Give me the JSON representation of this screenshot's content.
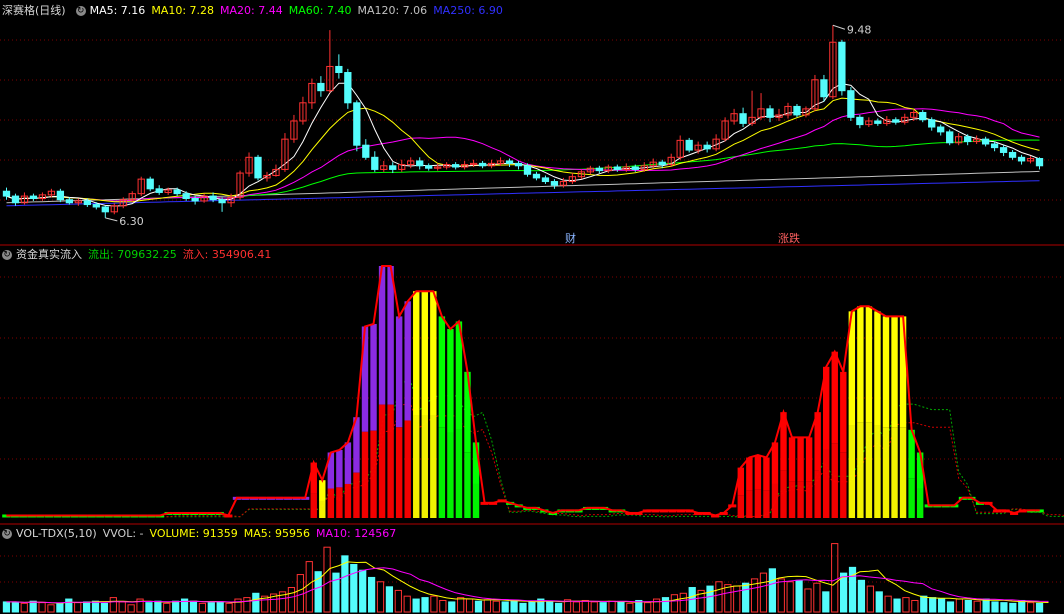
{
  "colors": {
    "background": "#000000",
    "up": "#ff3232",
    "down": "#54fcfc",
    "panel_border": "#b00000",
    "grid": "#800000",
    "ma5": "#ffffff",
    "ma10": "#ffff00",
    "ma20": "#ff00ff",
    "ma60": "#00ff00",
    "ma120": "#c0c0c0",
    "ma250": "#3030ff",
    "flow_out": "#00ff00",
    "flow_in": "#ff0000",
    "purple": "#8a2be2",
    "yellow": "#ffff00"
  },
  "price_panel": {
    "title": "深赛格(日线)",
    "settings_icon": "circle-arrow-icon",
    "indicators": [
      {
        "label": "MA5: 7.16",
        "color": "#ffffff"
      },
      {
        "label": "MA10: 7.28",
        "color": "#ffff00"
      },
      {
        "label": "MA20: 7.44",
        "color": "#ff00ff"
      },
      {
        "label": "MA60: 7.40",
        "color": "#00ff00"
      },
      {
        "label": "MA120: 7.06",
        "color": "#c0c0c0"
      },
      {
        "label": "MA250: 6.90",
        "color": "#3030ff"
      }
    ],
    "high_label": "9.48",
    "low_label": "6.30",
    "markers": [
      {
        "label": "财",
        "color": "#8ab4ff"
      },
      {
        "label": "涨跌",
        "color": "#ff6060"
      }
    ]
  },
  "flow_panel": {
    "title": "资金真实流入",
    "outflow_label": "流出: 709632.25",
    "inflow_label": "流入: 354906.41"
  },
  "volume_panel": {
    "title": "VOL-TDX(5,10)",
    "vvol_label": "VVOL: -",
    "volume_label": "VOLUME: 91359",
    "ma5_label": "MA5: 95956",
    "ma10_label": "MA10: 124567"
  },
  "chart_data": [
    {
      "type": "candlestick",
      "title": "深赛格(日线)",
      "y_range": [
        6.1,
        9.6
      ],
      "annotations": {
        "high": 9.48,
        "low": 6.3
      },
      "candles": [
        [
          6.74,
          6.66,
          6.8,
          6.6
        ],
        [
          6.66,
          6.55,
          6.7,
          6.5
        ],
        [
          6.55,
          6.66,
          6.72,
          6.52
        ],
        [
          6.66,
          6.62,
          6.7,
          6.58
        ],
        [
          6.62,
          6.68,
          6.72,
          6.58
        ],
        [
          6.68,
          6.74,
          6.78,
          6.64
        ],
        [
          6.74,
          6.6,
          6.78,
          6.56
        ],
        [
          6.6,
          6.55,
          6.64,
          6.52
        ],
        [
          6.55,
          6.58,
          6.62,
          6.5
        ],
        [
          6.58,
          6.52,
          6.62,
          6.48
        ],
        [
          6.52,
          6.48,
          6.56,
          6.44
        ],
        [
          6.48,
          6.4,
          6.5,
          6.3
        ],
        [
          6.4,
          6.5,
          6.54,
          6.36
        ],
        [
          6.5,
          6.6,
          6.64,
          6.46
        ],
        [
          6.6,
          6.7,
          6.74,
          6.56
        ],
        [
          6.7,
          6.94,
          6.98,
          6.66
        ],
        [
          6.94,
          6.78,
          6.98,
          6.74
        ],
        [
          6.78,
          6.72,
          6.84,
          6.68
        ],
        [
          6.72,
          6.76,
          6.8,
          6.68
        ],
        [
          6.76,
          6.7,
          6.8,
          6.66
        ],
        [
          6.7,
          6.62,
          6.74,
          6.58
        ],
        [
          6.62,
          6.58,
          6.66,
          6.52
        ],
        [
          6.58,
          6.66,
          6.7,
          6.55
        ],
        [
          6.66,
          6.6,
          6.72,
          6.56
        ],
        [
          6.6,
          6.55,
          6.64,
          6.4
        ],
        [
          6.55,
          6.64,
          6.7,
          6.48
        ],
        [
          6.64,
          7.04,
          7.08,
          6.6
        ],
        [
          7.04,
          7.3,
          7.38,
          6.98
        ],
        [
          7.3,
          6.96,
          7.34,
          6.92
        ],
        [
          6.96,
          7.0,
          7.06,
          6.9
        ],
        [
          7.0,
          7.1,
          7.18,
          6.98
        ],
        [
          7.1,
          7.6,
          7.7,
          7.06
        ],
        [
          7.6,
          7.9,
          8.0,
          7.54
        ],
        [
          7.9,
          8.2,
          8.3,
          7.84
        ],
        [
          8.2,
          8.52,
          8.6,
          8.1
        ],
        [
          8.52,
          8.4,
          8.64,
          8.3
        ],
        [
          8.4,
          8.8,
          9.4,
          8.36
        ],
        [
          8.8,
          8.7,
          9.0,
          8.6
        ],
        [
          8.7,
          8.2,
          8.76,
          8.1
        ],
        [
          8.2,
          7.5,
          8.24,
          7.4
        ],
        [
          7.5,
          7.3,
          7.6,
          7.26
        ],
        [
          7.3,
          7.1,
          7.4,
          7.06
        ],
        [
          7.1,
          7.16,
          7.24,
          7.06
        ],
        [
          7.16,
          7.1,
          7.22,
          7.04
        ],
        [
          7.1,
          7.18,
          7.26,
          7.06
        ],
        [
          7.18,
          7.24,
          7.3,
          7.12
        ],
        [
          7.24,
          7.16,
          7.3,
          7.1
        ],
        [
          7.16,
          7.12,
          7.2,
          7.08
        ],
        [
          7.12,
          7.14,
          7.2,
          7.08
        ],
        [
          7.14,
          7.18,
          7.22,
          7.1
        ],
        [
          7.18,
          7.14,
          7.22,
          7.1
        ],
        [
          7.14,
          7.18,
          7.24,
          7.1
        ],
        [
          7.18,
          7.2,
          7.26,
          7.14
        ],
        [
          7.2,
          7.16,
          7.24,
          7.12
        ],
        [
          7.16,
          7.2,
          7.26,
          7.12
        ],
        [
          7.2,
          7.24,
          7.3,
          7.16
        ],
        [
          7.24,
          7.2,
          7.28,
          7.14
        ],
        [
          7.2,
          7.16,
          7.24,
          7.1
        ],
        [
          7.16,
          7.02,
          7.2,
          6.98
        ],
        [
          7.02,
          6.96,
          7.06,
          6.92
        ],
        [
          6.96,
          6.9,
          7.0,
          6.86
        ],
        [
          6.9,
          6.84,
          6.94,
          6.78
        ],
        [
          6.84,
          6.9,
          6.96,
          6.8
        ],
        [
          6.9,
          6.98,
          7.04,
          6.86
        ],
        [
          6.98,
          7.06,
          7.1,
          6.94
        ],
        [
          7.06,
          7.12,
          7.16,
          7.02
        ],
        [
          7.12,
          7.08,
          7.16,
          7.04
        ],
        [
          7.08,
          7.14,
          7.18,
          7.04
        ],
        [
          7.14,
          7.1,
          7.18,
          7.06
        ],
        [
          7.1,
          7.14,
          7.2,
          7.06
        ],
        [
          7.14,
          7.1,
          7.18,
          7.06
        ],
        [
          7.1,
          7.16,
          7.22,
          7.06
        ],
        [
          7.16,
          7.22,
          7.28,
          7.12
        ],
        [
          7.22,
          7.18,
          7.26,
          7.12
        ],
        [
          7.18,
          7.3,
          7.36,
          7.14
        ],
        [
          7.3,
          7.58,
          7.66,
          7.26
        ],
        [
          7.58,
          7.42,
          7.62,
          7.38
        ],
        [
          7.42,
          7.5,
          7.56,
          7.36
        ],
        [
          7.5,
          7.44,
          7.56,
          7.38
        ],
        [
          7.44,
          7.6,
          7.68,
          7.4
        ],
        [
          7.6,
          7.9,
          7.96,
          7.56
        ],
        [
          7.9,
          8.02,
          8.1,
          7.84
        ],
        [
          8.02,
          7.86,
          8.12,
          7.8
        ],
        [
          7.86,
          7.96,
          8.4,
          7.82
        ],
        [
          7.96,
          8.1,
          8.36,
          7.92
        ],
        [
          8.1,
          7.96,
          8.16,
          7.88
        ],
        [
          7.96,
          8.0,
          8.1,
          7.9
        ],
        [
          8.0,
          8.14,
          8.2,
          7.94
        ],
        [
          8.14,
          8.0,
          8.18,
          7.96
        ],
        [
          8.0,
          8.1,
          8.14,
          7.96
        ],
        [
          8.1,
          8.58,
          8.66,
          8.06
        ],
        [
          8.58,
          8.3,
          8.66,
          8.22
        ],
        [
          8.3,
          9.2,
          9.48,
          8.26
        ],
        [
          9.2,
          8.4,
          9.24,
          8.32
        ],
        [
          8.4,
          7.96,
          8.46,
          7.9
        ],
        [
          7.96,
          7.84,
          8.0,
          7.78
        ],
        [
          7.84,
          7.9,
          7.96,
          7.8
        ],
        [
          7.9,
          7.86,
          7.94,
          7.82
        ],
        [
          7.86,
          7.92,
          7.98,
          7.82
        ],
        [
          7.92,
          7.88,
          7.96,
          7.84
        ],
        [
          7.88,
          7.96,
          8.02,
          7.84
        ],
        [
          7.96,
          8.04,
          8.08,
          7.9
        ],
        [
          8.04,
          7.92,
          8.08,
          7.88
        ],
        [
          7.92,
          7.8,
          7.96,
          7.74
        ],
        [
          7.8,
          7.72,
          7.84,
          7.66
        ],
        [
          7.72,
          7.54,
          7.76,
          7.5
        ],
        [
          7.54,
          7.64,
          7.7,
          7.5
        ],
        [
          7.64,
          7.56,
          7.68,
          7.5
        ],
        [
          7.56,
          7.6,
          7.66,
          7.52
        ],
        [
          7.6,
          7.52,
          7.64,
          7.48
        ],
        [
          7.52,
          7.46,
          7.56,
          7.4
        ],
        [
          7.46,
          7.38,
          7.5,
          7.32
        ],
        [
          7.38,
          7.3,
          7.42,
          7.26
        ],
        [
          7.3,
          7.24,
          7.34,
          7.18
        ],
        [
          7.24,
          7.28,
          7.32,
          7.2
        ],
        [
          7.28,
          7.16,
          7.3,
          7.1
        ]
      ]
    },
    {
      "type": "bar",
      "title": "资金真实流入",
      "y_range": [
        0,
        1.0
      ],
      "values": [
        0.01,
        0.01,
        0.01,
        0.01,
        0.01,
        0.01,
        0.01,
        0.01,
        0.01,
        0.01,
        0.01,
        0.01,
        0.01,
        0.01,
        0.01,
        0.01,
        0.01,
        0.01,
        0.01,
        0.02,
        0.02,
        0.02,
        0.02,
        0.02,
        0.02,
        0.02,
        0.01,
        0.08,
        0.08,
        0.08,
        0.08,
        0.08,
        0.08,
        0.08,
        0.08,
        0.08,
        0.22,
        0.15,
        0.26,
        0.27,
        0.3,
        0.4,
        0.76,
        0.77,
        1.0,
        1.0,
        0.8,
        0.86,
        0.9,
        0.9,
        0.9,
        0.8,
        0.75,
        0.78,
        0.58,
        0.3,
        0.06,
        0.06,
        0.07,
        0.06,
        0.05,
        0.04,
        0.04,
        0.03,
        0.02,
        0.03,
        0.03,
        0.03,
        0.04,
        0.04,
        0.04,
        0.03,
        0.03,
        0.02,
        0.02,
        0.03,
        0.03,
        0.03,
        0.03,
        0.03,
        0.03,
        0.02,
        0.02,
        0.01,
        0.02,
        0.05,
        0.2,
        0.24,
        0.25,
        0.24,
        0.3,
        0.42,
        0.32,
        0.32,
        0.32,
        0.42,
        0.6,
        0.66,
        0.58,
        0.82,
        0.84,
        0.84,
        0.82,
        0.8,
        0.8,
        0.8,
        0.35,
        0.26,
        0.05,
        0.05,
        0.05,
        0.05,
        0.08,
        0.08,
        0.06,
        0.06,
        0.03,
        0.03,
        0.02,
        0.03,
        0.03,
        0.03
      ],
      "colors": [
        "g",
        "g",
        "g",
        "g",
        "g",
        "g",
        "g",
        "g",
        "g",
        "g",
        "g",
        "g",
        "g",
        "g",
        "g",
        "g",
        "g",
        "g",
        "g",
        "g",
        "g",
        "g",
        "g",
        "g",
        "g",
        "g",
        "r",
        "p",
        "p",
        "p",
        "p",
        "p",
        "p",
        "p",
        "p",
        "p",
        "r",
        "y",
        "p",
        "p",
        "p",
        "p",
        "p",
        "p",
        "p",
        "p",
        "p",
        "p",
        "y",
        "y",
        "y",
        "g",
        "g",
        "g",
        "g",
        "g",
        "r",
        "r",
        "r",
        "g",
        "g",
        "g",
        "g",
        "g",
        "g",
        "g",
        "g",
        "g",
        "g",
        "g",
        "g",
        "g",
        "g",
        "r",
        "r",
        "r",
        "r",
        "r",
        "r",
        "r",
        "r",
        "r",
        "r",
        "r",
        "r",
        "r",
        "r",
        "r",
        "r",
        "r",
        "r",
        "r",
        "r",
        "r",
        "r",
        "r",
        "r",
        "r",
        "r",
        "y",
        "y",
        "y",
        "y",
        "y",
        "y",
        "y",
        "g",
        "g",
        "g",
        "g",
        "g",
        "g",
        "g",
        "g",
        "g",
        "r",
        "r",
        "r",
        "r",
        "r",
        "g",
        "g"
      ]
    },
    {
      "type": "bar",
      "title": "VOL-TDX(5,10)",
      "series": [
        {
          "name": "VOLUME",
          "value": 91359
        },
        {
          "name": "MA5",
          "value": 95956
        },
        {
          "name": "MA10",
          "value": 124567
        }
      ],
      "y_range": [
        0,
        1.0
      ],
      "values": [
        0.14,
        0.14,
        0.12,
        0.15,
        0.13,
        0.1,
        0.12,
        0.18,
        0.13,
        0.14,
        0.15,
        0.12,
        0.2,
        0.14,
        0.1,
        0.18,
        0.13,
        0.15,
        0.12,
        0.15,
        0.18,
        0.15,
        0.12,
        0.13,
        0.14,
        0.12,
        0.18,
        0.2,
        0.26,
        0.22,
        0.25,
        0.28,
        0.34,
        0.52,
        0.7,
        0.56,
        0.9,
        0.54,
        0.78,
        0.66,
        0.58,
        0.48,
        0.42,
        0.35,
        0.3,
        0.22,
        0.18,
        0.2,
        0.22,
        0.16,
        0.14,
        0.2,
        0.18,
        0.15,
        0.17,
        0.15,
        0.14,
        0.16,
        0.12,
        0.14,
        0.18,
        0.15,
        0.12,
        0.17,
        0.14,
        0.16,
        0.14,
        0.13,
        0.15,
        0.14,
        0.12,
        0.16,
        0.13,
        0.18,
        0.2,
        0.24,
        0.26,
        0.34,
        0.3,
        0.36,
        0.42,
        0.38,
        0.36,
        0.4,
        0.46,
        0.54,
        0.6,
        0.46,
        0.42,
        0.44,
        0.32,
        0.4,
        0.28,
        0.95,
        0.54,
        0.62,
        0.44,
        0.36,
        0.28,
        0.22,
        0.18,
        0.2,
        0.16,
        0.22,
        0.2,
        0.18,
        0.14,
        0.18,
        0.16,
        0.15,
        0.18,
        0.14,
        0.13,
        0.12,
        0.16,
        0.13,
        0.12
      ]
    }
  ]
}
